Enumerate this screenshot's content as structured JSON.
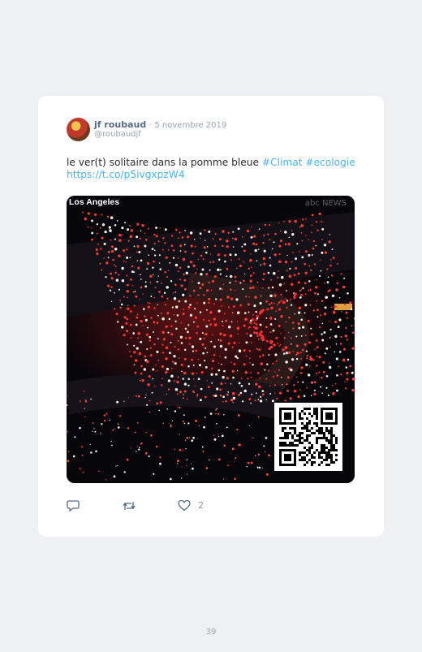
{
  "tweet": {
    "author_name": "jf roubaud",
    "separator": "·",
    "date": "5 novembre 2019",
    "handle": "@roubaudjf",
    "text": "le ver(t) solitaire dans la pomme bleue",
    "hashtags": [
      "#Climat",
      "#ecologie"
    ],
    "link": "https://t.co/p5ivgxpzW4",
    "media": {
      "location_label": "Los Angeles",
      "watermark": "abc NEWS"
    },
    "actions": {
      "reply_count": "",
      "retweet_count": "",
      "like_count": "2"
    }
  },
  "colors": {
    "link": "#4cb3e6",
    "author": "#556b86",
    "muted": "#9aa4b0",
    "background": "#eef0f3",
    "card": "#ffffff"
  },
  "icons": [
    "reply-icon",
    "retweet-icon",
    "heart-icon"
  ],
  "page_number": "39"
}
